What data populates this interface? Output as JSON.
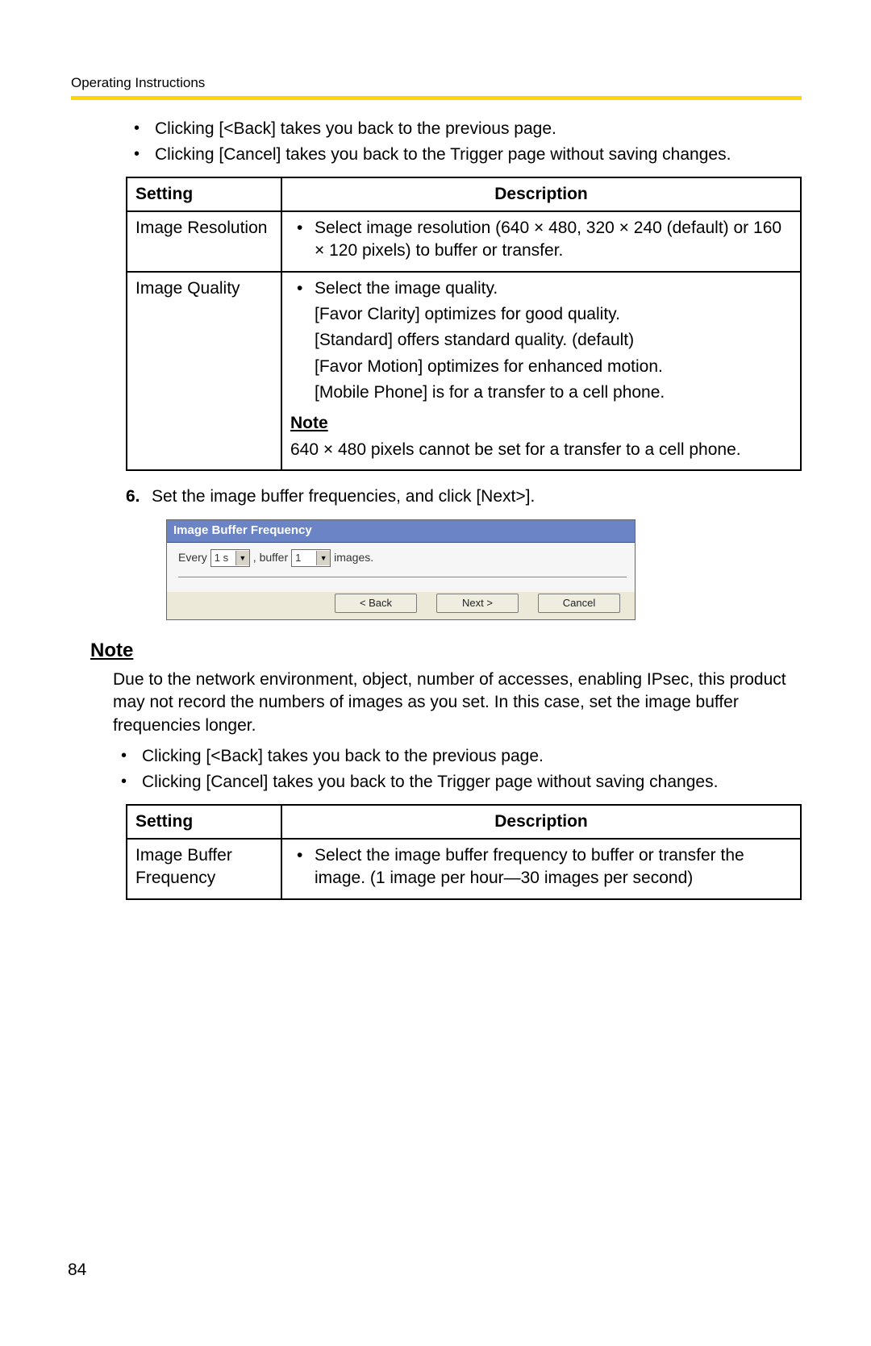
{
  "header": "Operating Instructions",
  "intro_bullets": [
    "Clicking [<Back] takes you back to the previous page.",
    "Clicking [Cancel] takes you back to the Trigger page without saving changes."
  ],
  "table1": {
    "headers": {
      "setting": "Setting",
      "description": "Description"
    },
    "rows": [
      {
        "setting": "Image Resolution",
        "desc_bullet": "Select image resolution (640 × 480, 320 × 240 (default) or 160 × 120 pixels) to buffer or transfer."
      },
      {
        "setting": "Image Quality",
        "desc_bullet": "Select the image quality.",
        "extra_lines": [
          "[Favor Clarity] optimizes for good quality.",
          "[Standard] offers standard quality. (default)",
          "[Favor Motion] optimizes for enhanced motion.",
          "[Mobile Phone] is for a transfer to a cell phone."
        ],
        "note_head": "Note",
        "note_text": "640 × 480 pixels cannot be set for a transfer to a cell phone."
      }
    ]
  },
  "step6": {
    "num": "6.",
    "text": "Set the image buffer frequencies, and click [Next>]."
  },
  "ui": {
    "title": "Image Buffer Frequency",
    "label_every": "Every",
    "dd_time": "1 s",
    "label_buffer": ", buffer",
    "dd_count": "1",
    "label_images": "images.",
    "btn_back": "< Back",
    "btn_next": "Next >",
    "btn_cancel": "Cancel"
  },
  "outer_note": {
    "head": "Note",
    "body": "Due to the network environment, object, number of accesses, enabling IPsec, this product may not record the numbers of images as you set. In this case, set the image buffer frequencies longer.",
    "bullets": [
      "Clicking [<Back] takes you back to the previous page.",
      "Clicking [Cancel] takes you back to the Trigger page without saving changes."
    ]
  },
  "table2": {
    "headers": {
      "setting": "Setting",
      "description": "Description"
    },
    "rows": [
      {
        "setting": "Image Buffer Frequency",
        "desc_bullet": "Select the image buffer frequency to buffer or transfer the image. (1 image per hour—30 images per second)"
      }
    ]
  },
  "page_num": "84"
}
